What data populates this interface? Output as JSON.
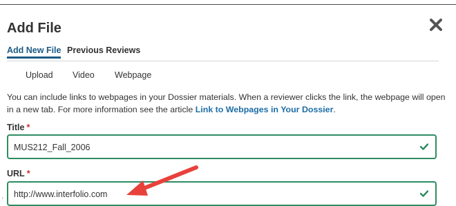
{
  "modal": {
    "title": "Add File",
    "close_icon": "close-icon"
  },
  "tabs": [
    {
      "label": "Add New File",
      "active": true
    },
    {
      "label": "Previous Reviews",
      "active": false
    }
  ],
  "subtabs": [
    "Upload",
    "Video",
    "Webpage"
  ],
  "description": {
    "text": "You can include links to webpages in your Dossier materials. When a reviewer clicks the link, the webpage will open in a new tab. For more information see the article ",
    "link": "Link to Webpages in Your Dossier",
    "suffix": "."
  },
  "fields": {
    "title": {
      "label": "Title",
      "required_mark": "*",
      "value": "MUS212_Fall_2006",
      "valid_icon": "check-icon"
    },
    "url": {
      "label": "URL",
      "required_mark": "*",
      "value": "http://www.interfolio.com",
      "valid_icon": "check-icon"
    }
  },
  "annotation": {
    "type": "red-arrow",
    "color": "#e8413c"
  },
  "colors": {
    "accent": "#1c5a84",
    "link": "#1c6da6",
    "valid": "#2e8b62",
    "required": "#c9302c"
  }
}
